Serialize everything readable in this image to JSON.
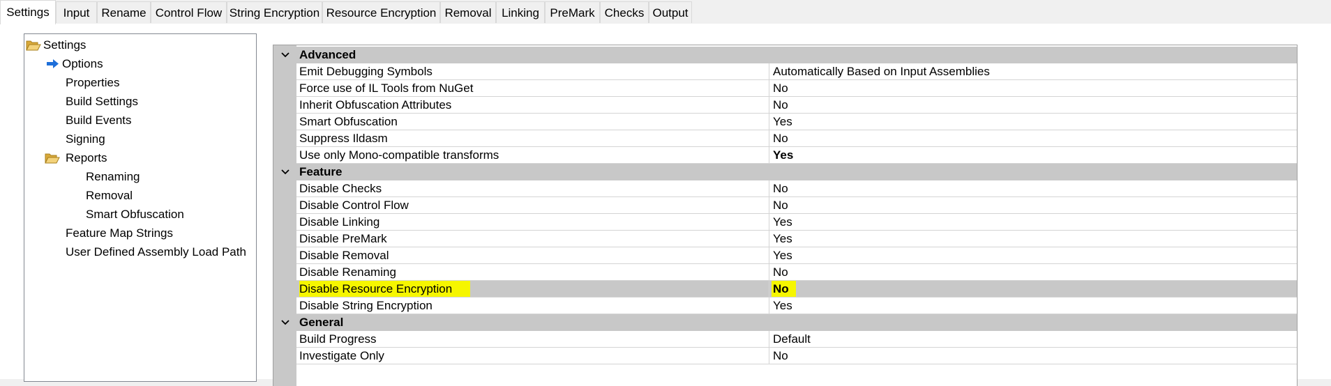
{
  "tabs": [
    {
      "label": "Settings",
      "active": true
    },
    {
      "label": "Input"
    },
    {
      "label": "Rename"
    },
    {
      "label": "Control Flow"
    },
    {
      "label": "String Encryption"
    },
    {
      "label": "Resource Encryption"
    },
    {
      "label": "Removal"
    },
    {
      "label": "Linking"
    },
    {
      "label": "PreMark"
    },
    {
      "label": "Checks"
    },
    {
      "label": "Output"
    }
  ],
  "tree": {
    "root": "Settings",
    "options": "Options",
    "properties": "Properties",
    "build_settings": "Build Settings",
    "build_events": "Build Events",
    "signing": "Signing",
    "reports": "Reports",
    "renaming": "Renaming",
    "removal": "Removal",
    "smart_obfuscation": "Smart Obfuscation",
    "feature_map_strings": "Feature Map Strings",
    "user_defined_load_path": "User Defined Assembly Load Path"
  },
  "grid": {
    "advanced": {
      "name": "Advanced",
      "rows": [
        {
          "name": "Emit Debugging Symbols",
          "value": "Automatically Based on Input Assemblies"
        },
        {
          "name": "Force use of IL Tools from NuGet",
          "value": "No"
        },
        {
          "name": "Inherit Obfuscation Attributes",
          "value": "No"
        },
        {
          "name": "Smart Obfuscation",
          "value": "Yes"
        },
        {
          "name": "Suppress Ildasm",
          "value": "No"
        },
        {
          "name": "Use only Mono-compatible transforms",
          "value": "Yes"
        }
      ]
    },
    "feature": {
      "name": "Feature",
      "rows": [
        {
          "name": "Disable Checks",
          "value": "No"
        },
        {
          "name": "Disable Control Flow",
          "value": "No"
        },
        {
          "name": "Disable Linking",
          "value": "Yes"
        },
        {
          "name": "Disable PreMark",
          "value": "Yes"
        },
        {
          "name": "Disable Removal",
          "value": "Yes"
        },
        {
          "name": "Disable Renaming",
          "value": "No"
        },
        {
          "name": "Disable Resource Encryption",
          "value": "No"
        },
        {
          "name": "Disable String Encryption",
          "value": "Yes"
        }
      ]
    },
    "general": {
      "name": "General",
      "rows": [
        {
          "name": "Build Progress",
          "value": "Default"
        },
        {
          "name": "Investigate Only",
          "value": "No"
        }
      ]
    }
  },
  "colors": {
    "highlight": "#f6f600",
    "category_bg": "#c8c8c8",
    "arrow_blue": "#1e6fd9",
    "folder_yellow": "#e8c15a"
  }
}
